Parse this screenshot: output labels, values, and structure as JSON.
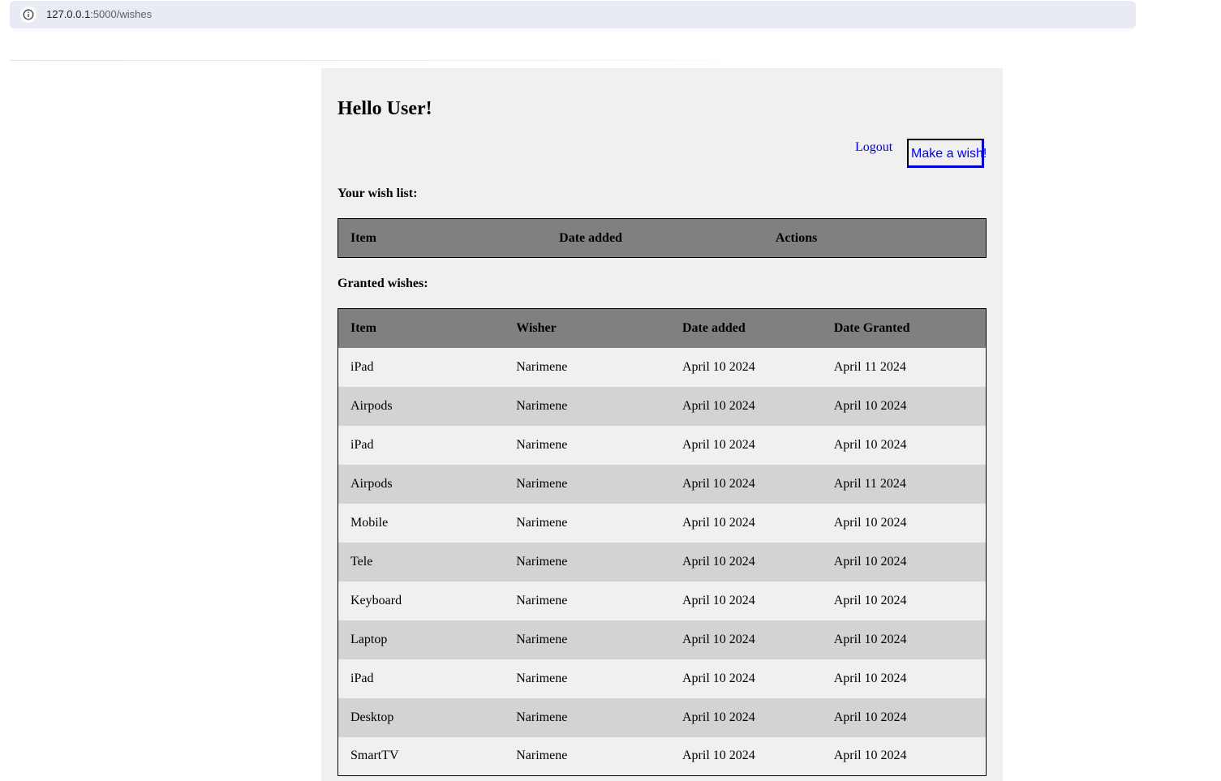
{
  "browser": {
    "url_host": "127.0.0.1",
    "url_path": ":5000/wishes"
  },
  "page": {
    "greeting": "Hello User!",
    "logout_label": "Logout",
    "make_wish_label": "Make a wish!"
  },
  "wish_list": {
    "title": "Your wish list:",
    "headers": [
      "Item",
      "Date added",
      "Actions"
    ],
    "rows": []
  },
  "granted": {
    "title": "Granted wishes:",
    "headers": [
      "Item",
      "Wisher",
      "Date added",
      "Date Granted"
    ],
    "rows": [
      [
        "iPad",
        "Narimene",
        "April 10 2024",
        "April 11 2024"
      ],
      [
        "Airpods",
        "Narimene",
        "April 10 2024",
        "April 10 2024"
      ],
      [
        "iPad",
        "Narimene",
        "April 10 2024",
        "April 10 2024"
      ],
      [
        "Airpods",
        "Narimene",
        "April 10 2024",
        "April 11 2024"
      ],
      [
        "Mobile",
        "Narimene",
        "April 10 2024",
        "April 10 2024"
      ],
      [
        "Tele",
        "Narimene",
        "April 10 2024",
        "April 10 2024"
      ],
      [
        "Keyboard",
        "Narimene",
        "April 10 2024",
        "April 10 2024"
      ],
      [
        "Laptop",
        "Narimene",
        "April 10 2024",
        "April 10 2024"
      ],
      [
        "iPad",
        "Narimene",
        "April 10 2024",
        "April 10 2024"
      ],
      [
        "Desktop",
        "Narimene",
        "April 10 2024",
        "April 10 2024"
      ],
      [
        "SmartTV",
        "Narimene",
        "April 10 2024",
        "April 10 2024"
      ]
    ]
  }
}
